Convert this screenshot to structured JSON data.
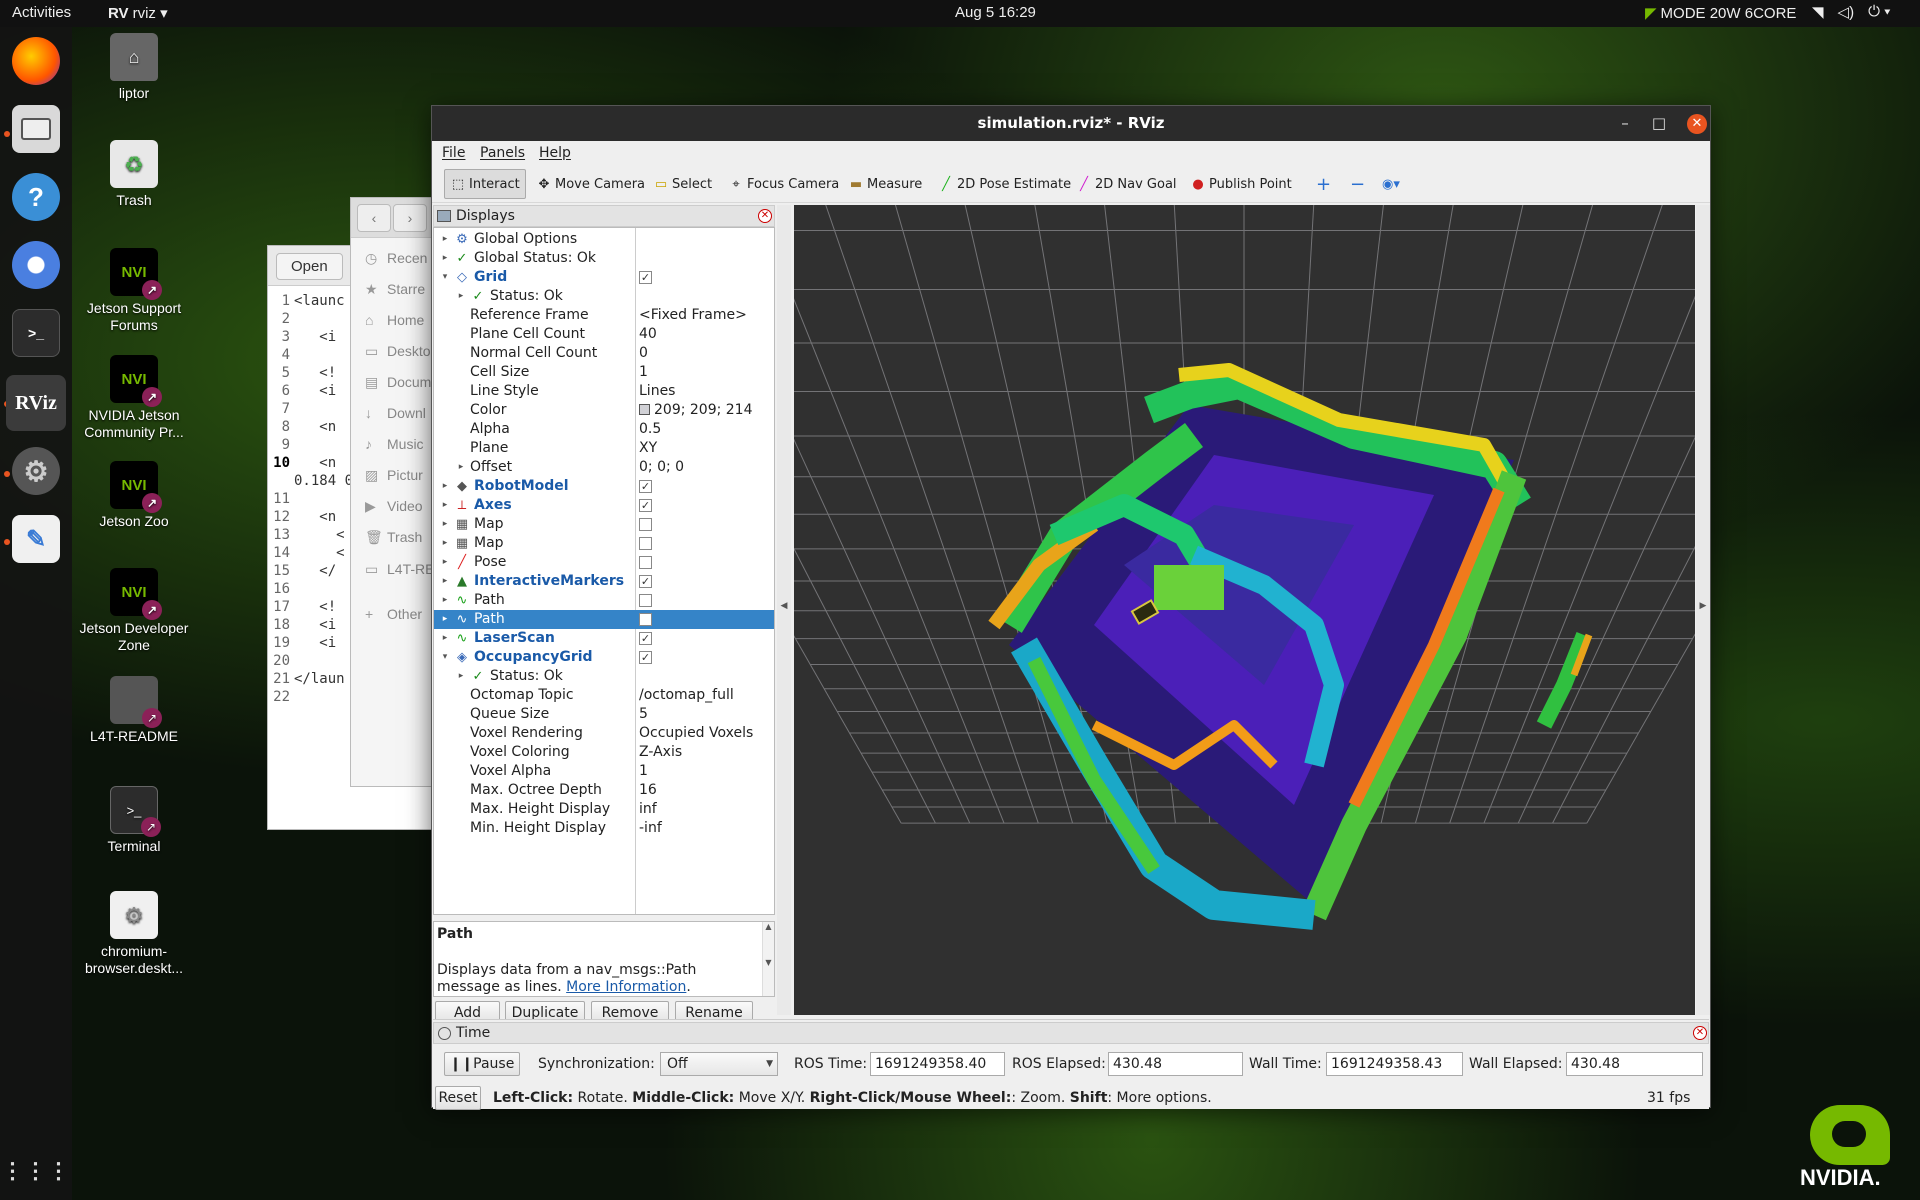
{
  "topbar": {
    "activities": "Activities",
    "app_name": "rviz",
    "clock": "Aug 5  16:29",
    "mode": "MODE 20W 6CORE"
  },
  "dock": {
    "items": [
      "firefox-icon",
      "files-icon",
      "help-icon",
      "chromium-icon",
      "terminal-icon",
      "rviz-icon",
      "settings-icon",
      "text-editor-icon",
      "app-grid-icon"
    ],
    "rviz_label": "RViz",
    "terminal_label": ">_"
  },
  "desktop": {
    "icons": [
      {
        "label": "liptor"
      },
      {
        "label": "Trash"
      },
      {
        "label": "Jetson Support Forums"
      },
      {
        "label": "NVIDIA Jetson Community Pr..."
      },
      {
        "label": "Jetson Zoo"
      },
      {
        "label": "Jetson Developer Zone"
      },
      {
        "label": "L4T-README"
      },
      {
        "label": "Terminal"
      },
      {
        "label": "chromium-browser.deskt..."
      }
    ],
    "nvidia_text": "NVI",
    "brand": "NVIDIA."
  },
  "editor": {
    "open_label": "Open",
    "lines": [
      {
        "n": "1",
        "t": "<launc"
      },
      {
        "n": "2",
        "t": ""
      },
      {
        "n": "3",
        "t": "   <i"
      },
      {
        "n": "4",
        "t": ""
      },
      {
        "n": "5",
        "t": "   <!"
      },
      {
        "n": "6",
        "t": "   <i"
      },
      {
        "n": "7",
        "t": ""
      },
      {
        "n": "8",
        "t": "   <n"
      },
      {
        "n": "9",
        "t": ""
      },
      {
        "n": "10",
        "t": "   <n"
      },
      {
        "n": "",
        "t": "0.184 0"
      },
      {
        "n": "11",
        "t": ""
      },
      {
        "n": "12",
        "t": "   <n"
      },
      {
        "n": "13",
        "t": "     <"
      },
      {
        "n": "14",
        "t": "     <"
      },
      {
        "n": "15",
        "t": "   </"
      },
      {
        "n": "16",
        "t": ""
      },
      {
        "n": "17",
        "t": "   <!"
      },
      {
        "n": "18",
        "t": "   <i"
      },
      {
        "n": "19",
        "t": "   <i"
      },
      {
        "n": "20",
        "t": ""
      },
      {
        "n": "21",
        "t": "</laun"
      },
      {
        "n": "22",
        "t": ""
      }
    ]
  },
  "files": {
    "items": [
      "Recen",
      "Starre",
      "Home",
      "Deskto",
      "Docum",
      "Downl",
      "Music",
      "Pictur",
      "Video",
      "Trash",
      "L4T-RE",
      "Other"
    ]
  },
  "rviz": {
    "title": "simulation.rviz* - RViz",
    "menu": [
      "File",
      "Panels",
      "Help"
    ],
    "tools": [
      "Interact",
      "Move Camera",
      "Select",
      "Focus Camera",
      "Measure",
      "2D Pose Estimate",
      "2D Nav Goal",
      "Publish Point"
    ],
    "displays_title": "Displays",
    "tree": [
      {
        "label": "Global Options",
        "arrow": "▸",
        "icon": "⚙",
        "depth": 0
      },
      {
        "label": "Global Status: Ok",
        "arrow": "▸",
        "icon": "✓",
        "depth": 0
      },
      {
        "label": "Grid",
        "arrow": "▾",
        "icon": "◇",
        "depth": 0,
        "blue": true,
        "check": true
      },
      {
        "label": "Status: Ok",
        "arrow": "▸",
        "icon": "✓",
        "depth": 1
      },
      {
        "label": "Reference Frame",
        "depth": 2,
        "value": "<Fixed Frame>"
      },
      {
        "label": "Plane Cell Count",
        "depth": 2,
        "value": "40"
      },
      {
        "label": "Normal Cell Count",
        "depth": 2,
        "value": "0"
      },
      {
        "label": "Cell Size",
        "depth": 2,
        "value": "1"
      },
      {
        "label": "Line Style",
        "depth": 2,
        "value": "Lines"
      },
      {
        "label": "Color",
        "depth": 2,
        "value": "209; 209; 214",
        "swatch": true
      },
      {
        "label": "Alpha",
        "depth": 2,
        "value": "0.5"
      },
      {
        "label": "Plane",
        "depth": 2,
        "value": "XY"
      },
      {
        "label": "Offset",
        "arrow": "▸",
        "depth": 1,
        "value": "0; 0; 0",
        "offset": true
      },
      {
        "label": "RobotModel",
        "arrow": "▸",
        "icon": "◆",
        "depth": 0,
        "blue": true,
        "check": true
      },
      {
        "label": "Axes",
        "arrow": "▸",
        "icon": "⟂",
        "depth": 0,
        "blue": true,
        "check": true
      },
      {
        "label": "Map",
        "arrow": "▸",
        "icon": "▦",
        "depth": 0,
        "check": false
      },
      {
        "label": "Map",
        "arrow": "▸",
        "icon": "▦",
        "depth": 0,
        "check": false
      },
      {
        "label": "Pose",
        "arrow": "▸",
        "icon": "╱",
        "depth": 0,
        "check": false
      },
      {
        "label": "InteractiveMarkers",
        "arrow": "▸",
        "icon": "▲",
        "depth": 0,
        "blue": true,
        "check": true
      },
      {
        "label": "Path",
        "arrow": "▸",
        "icon": "∿",
        "depth": 0,
        "check": false
      },
      {
        "label": "Path",
        "arrow": "▸",
        "icon": "∿",
        "depth": 0,
        "check": false,
        "selected": true
      },
      {
        "label": "LaserScan",
        "arrow": "▸",
        "icon": "∿",
        "depth": 0,
        "blue": true,
        "check": true
      },
      {
        "label": "OccupancyGrid",
        "arrow": "▾",
        "icon": "◈",
        "depth": 0,
        "blue": true,
        "check": true
      },
      {
        "label": "Status: Ok",
        "arrow": "▸",
        "icon": "✓",
        "depth": 1
      },
      {
        "label": "Octomap Topic",
        "depth": 2,
        "value": "/octomap_full"
      },
      {
        "label": "Queue Size",
        "depth": 2,
        "value": "5"
      },
      {
        "label": "Voxel Rendering",
        "depth": 2,
        "value": "Occupied Voxels"
      },
      {
        "label": "Voxel Coloring",
        "depth": 2,
        "value": "Z-Axis"
      },
      {
        "label": "Voxel Alpha",
        "depth": 2,
        "value": "1"
      },
      {
        "label": "Max. Octree Depth",
        "depth": 2,
        "value": "16"
      },
      {
        "label": "Max. Height Display",
        "depth": 2,
        "value": "inf"
      },
      {
        "label": "Min. Height Display",
        "depth": 2,
        "value": "-inf"
      }
    ],
    "desc_title": "Path",
    "desc_text": "Displays data from a nav_msgs::Path message as lines.",
    "desc_link": "More Information",
    "buttons": [
      "Add",
      "Duplicate",
      "Remove",
      "Rename"
    ],
    "time": {
      "title": "Time",
      "pause_label": "Pause",
      "sync_label": "Synchronization:",
      "sync_value": "Off",
      "ros_time_label": "ROS Time:",
      "ros_time": "1691249358.40",
      "ros_elapsed_label": "ROS Elapsed:",
      "ros_elapsed": "430.48",
      "wall_time_label": "Wall Time:",
      "wall_time": "1691249358.43",
      "wall_elapsed_label": "Wall Elapsed:",
      "wall_elapsed": "430.48",
      "reset_label": "Reset",
      "status": {
        "k1": "Left-Click:",
        "v1": " Rotate. ",
        "k2": "Middle-Click:",
        "v2": " Move X/Y. ",
        "k3": "Right-Click/Mouse Wheel:",
        "v3": ": Zoom. ",
        "k4": "Shift",
        "v4": ": More options."
      },
      "fps": "31 fps"
    }
  }
}
